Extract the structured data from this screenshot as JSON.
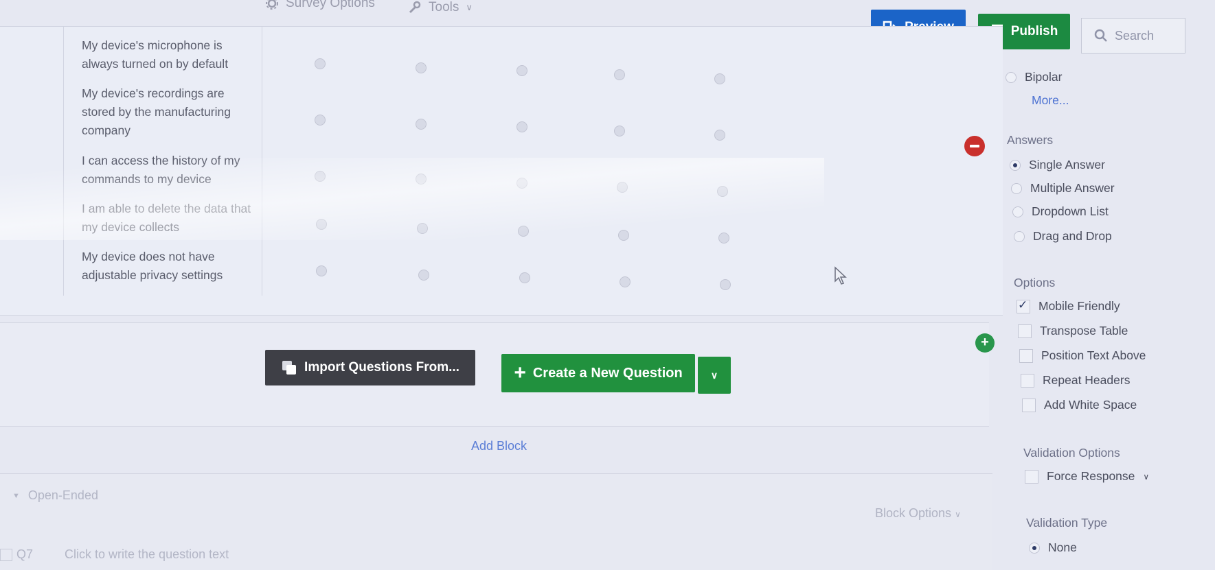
{
  "toolbar": {
    "survey_options_label": "Survey Options",
    "tools_label": "Tools",
    "preview_label": "Preview",
    "publish_label": "Publish",
    "search_placeholder": "Search"
  },
  "matrix": {
    "rows": [
      "My device's microphone is always turned on by default",
      "My device's recordings are stored by the manufacturing company",
      "I can access the history of my commands to my device",
      "I am able to delete the data that my device collects",
      "My device does not have adjustable privacy settings"
    ],
    "columns_count": 5
  },
  "actions": {
    "import_label": "Import Questions From...",
    "create_label": "Create a New Question",
    "add_block_label": "Add Block"
  },
  "lower_block": {
    "title": "Open-Ended",
    "block_options_label": "Block Options",
    "question_id": "Q7",
    "question_placeholder": "Click to write the question text"
  },
  "side_panel": {
    "bipolar_label": "Bipolar",
    "more_label": "More...",
    "answers_title": "Answers",
    "answers": [
      {
        "label": "Single Answer",
        "selected": true
      },
      {
        "label": "Multiple Answer",
        "selected": false
      },
      {
        "label": "Dropdown List",
        "selected": false
      },
      {
        "label": "Drag and Drop",
        "selected": false
      }
    ],
    "options_title": "Options",
    "options": [
      {
        "label": "Mobile Friendly",
        "checked": true
      },
      {
        "label": "Transpose Table",
        "checked": false
      },
      {
        "label": "Position Text Above",
        "checked": false
      },
      {
        "label": "Repeat Headers",
        "checked": false
      },
      {
        "label": "Add White Space",
        "checked": false
      }
    ],
    "validation_title": "Validation Options",
    "force_response_label": "Force Response",
    "validation_type_title": "Validation Type",
    "validation_none_label": "None"
  },
  "colors": {
    "preview": "#1b64c8",
    "publish": "#1c8a41",
    "create": "#21913e",
    "import": "#3e3f46",
    "remove": "#c9302c"
  }
}
